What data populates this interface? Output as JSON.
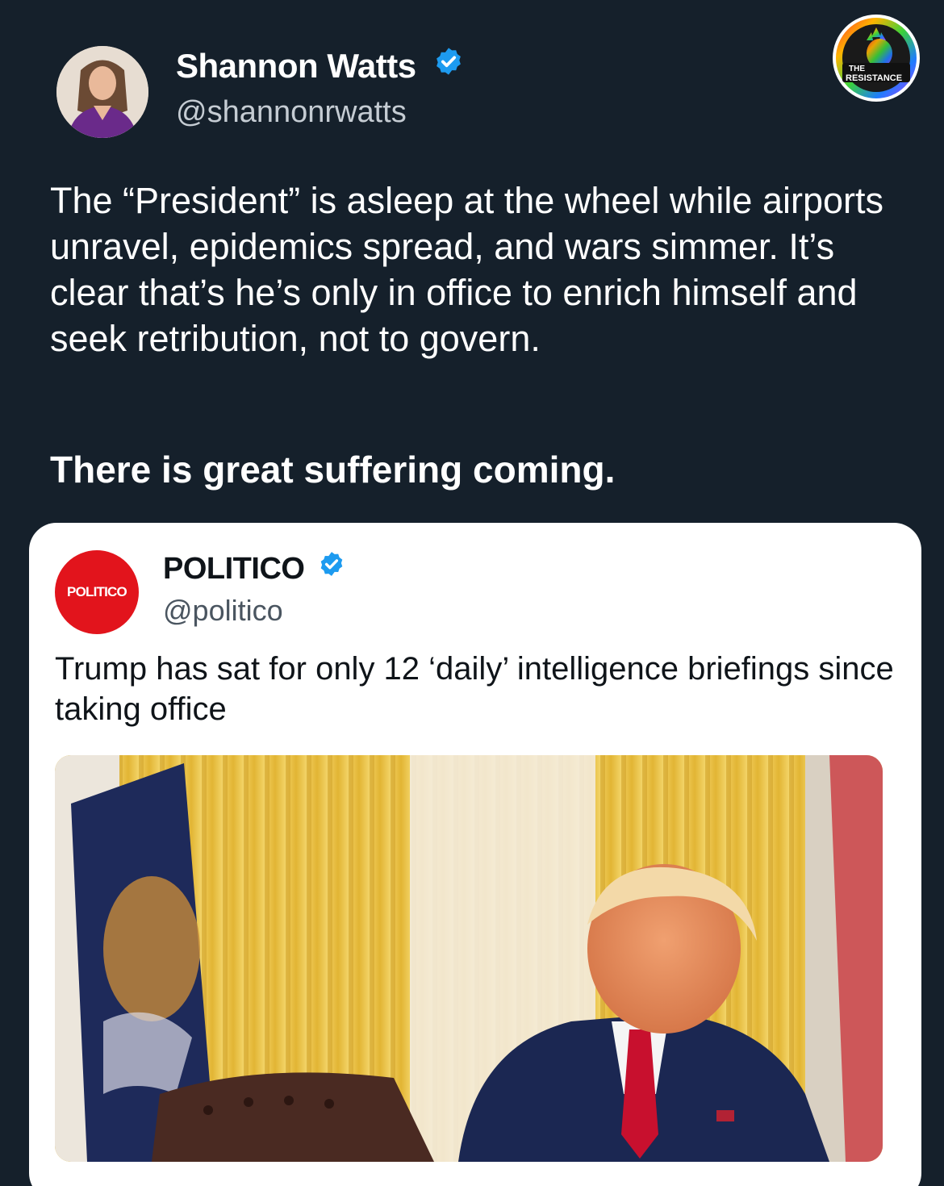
{
  "author": {
    "name": "Shannon Watts",
    "handle": "@shannonrwatts",
    "verified_icon": "verified-badge-icon"
  },
  "badge": {
    "line1": "THE",
    "line2": "RESISTANCE"
  },
  "tweet": {
    "text": "The “President” is asleep at the wheel while airports unravel, epidemics spread, and wars simmer. It’s clear that’s he’s only in office to enrich himself and seek retribution, not to govern.",
    "emphasis": "There is great suffering coming."
  },
  "quote": {
    "avatar_text": "POLITICO",
    "name": "POLITICO",
    "handle": "@politico",
    "text": "Trump has sat for only 12 ‘daily’ intelligence briefings since taking office"
  },
  "colors": {
    "background": "#15202b",
    "verified": "#1d9bf0",
    "politico_red": "#e2141c"
  }
}
